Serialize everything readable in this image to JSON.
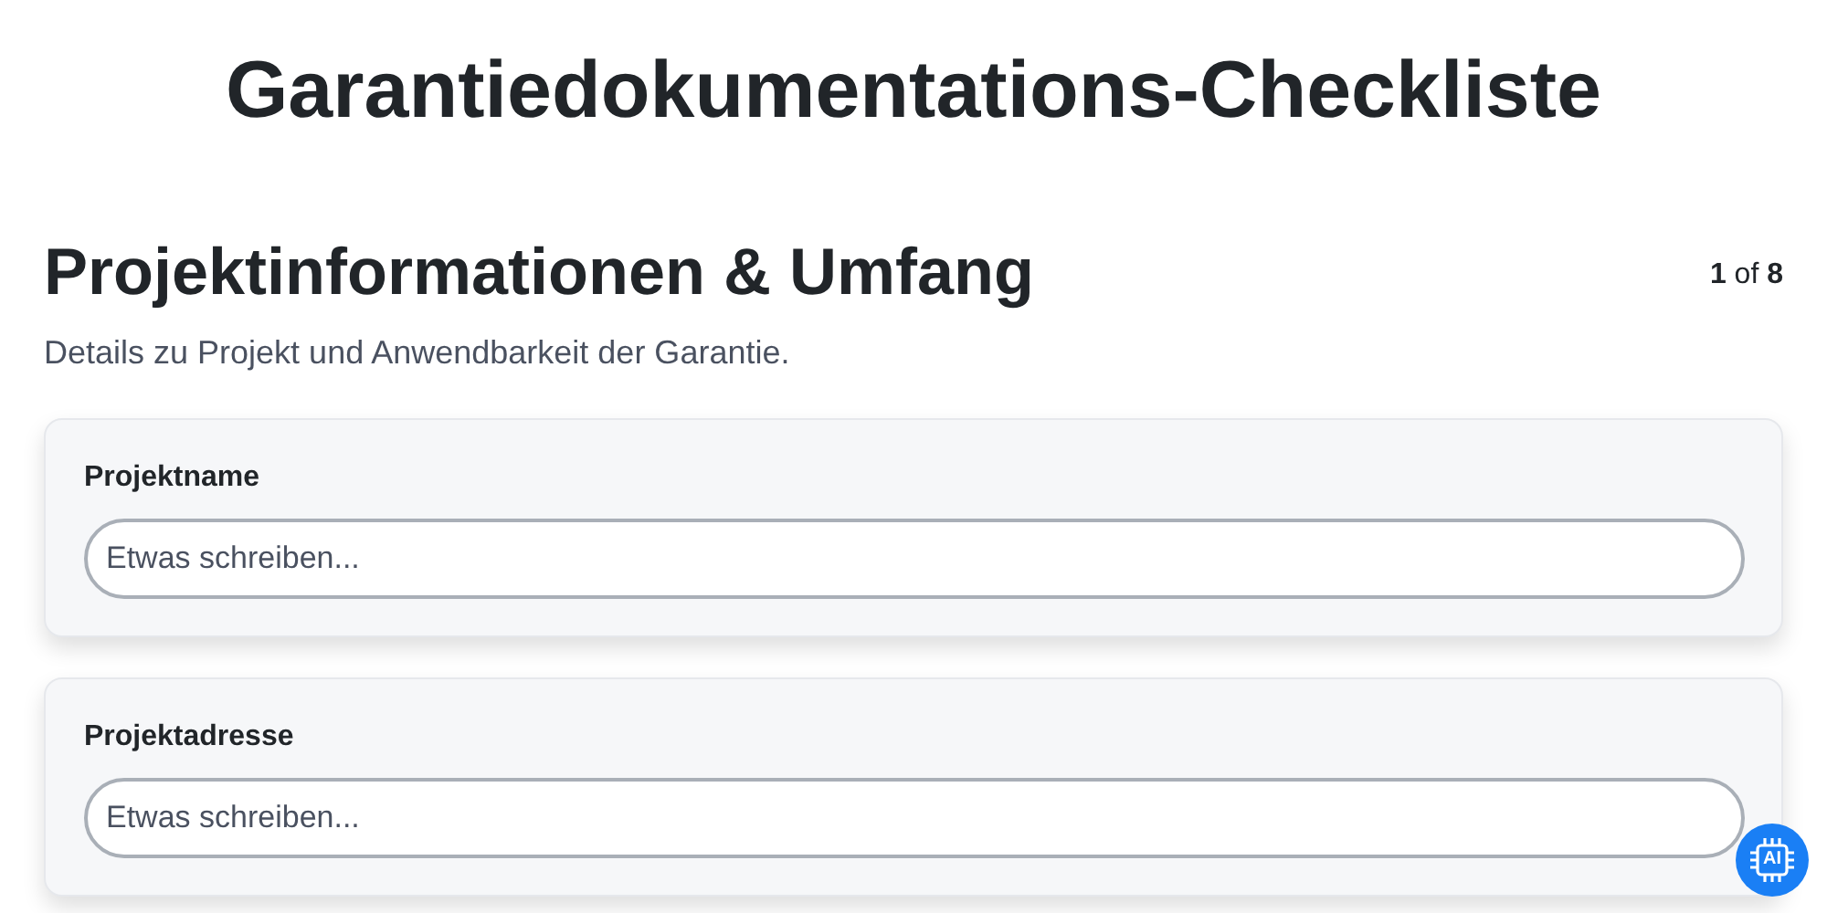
{
  "title": "Garantiedokumentations-Checkliste",
  "section": {
    "heading": "Projektinformationen & Umfang",
    "progress": "**1** of **8**",
    "description": "Details zu Projekt und Anwendbarkeit der Garantie."
  },
  "fields": [
    {
      "label": "Projektname",
      "placeholder": "Etwas schreiben..."
    },
    {
      "label": "Projektadresse",
      "placeholder": "Etwas schreiben..."
    }
  ],
  "assistant_button": {
    "label": "AI"
  }
}
